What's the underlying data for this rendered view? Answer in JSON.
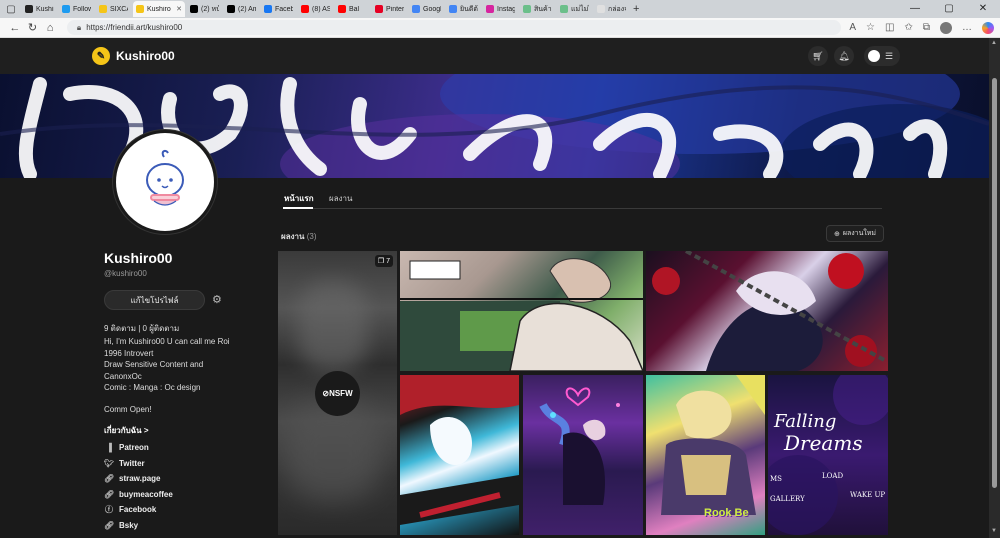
{
  "browser": {
    "tabs": [
      {
        "label": "Kushiro",
        "color": "#222222"
      },
      {
        "label": "Followi",
        "color": "#1d9bf0"
      },
      {
        "label": "SIXCATI",
        "color": "#f5c518"
      },
      {
        "label": "Kushiro",
        "color": "#f5c518",
        "active": true
      },
      {
        "label": "(2) หน้าแ",
        "color": "#000000"
      },
      {
        "label": "(2) Am",
        "color": "#000000"
      },
      {
        "label": "Facebo",
        "color": "#1877f2"
      },
      {
        "label": "(8) ASM",
        "color": "#ff0000"
      },
      {
        "label": "Bal",
        "color": "#ff0000"
      },
      {
        "label": "Pintere",
        "color": "#e60023"
      },
      {
        "label": "Google",
        "color": "#4285f4"
      },
      {
        "label": "ยินดีต้อนรั",
        "color": "#4285f4"
      },
      {
        "label": "Instagra",
        "color": "#d6249f"
      },
      {
        "label": "สินค้าสแท",
        "color": "#6bbf8a"
      },
      {
        "label": "แม่ไม่ใช่ไ",
        "color": "#6bbf8a"
      },
      {
        "label": "กล่องจด",
        "color": "#e0e0e0"
      }
    ],
    "url": "https://friendii.art/kushiro00"
  },
  "site": {
    "name": "Kushiro00"
  },
  "profile": {
    "name": "Kushiro00",
    "handle": "@kushiro00",
    "edit_label": "แก้ไขโปรไฟล์",
    "follow_stats": "9 ติดตาม   |   0 ผู้ติดตาม",
    "bio": "Hi, I'm Kushiro00 U can call me Roi\n1996 Introvert\nDraw Sensitive Content and\nCanonxOc\nComic : Manga : Oc design",
    "comm": "Comm Open!",
    "about_label": "เกี่ยวกับฉัน  >",
    "links": [
      {
        "label": "Patreon",
        "icon": "patreon-icon"
      },
      {
        "label": "Twitter",
        "icon": "twitter-icon"
      },
      {
        "label": "straw.page",
        "icon": "link-icon"
      },
      {
        "label": "buymeacoffee",
        "icon": "link-icon"
      },
      {
        "label": "Facebook",
        "icon": "facebook-icon"
      },
      {
        "label": "Bsky",
        "icon": "link-icon"
      }
    ]
  },
  "tabs": {
    "home": "หน้าแรก",
    "works": "ผลงาน"
  },
  "works": {
    "title": "ผลงาน",
    "count": "(3)",
    "new_label": "ผลงานใหม่",
    "nsfw_label": "NSFW",
    "image_count": "7",
    "falling": "Falling",
    "dreams": "Dreams",
    "ms": "MS",
    "load": "LOAD",
    "gallery": "GALLERY",
    "wake": "WAKE UP",
    "rook": "Rook Be"
  }
}
